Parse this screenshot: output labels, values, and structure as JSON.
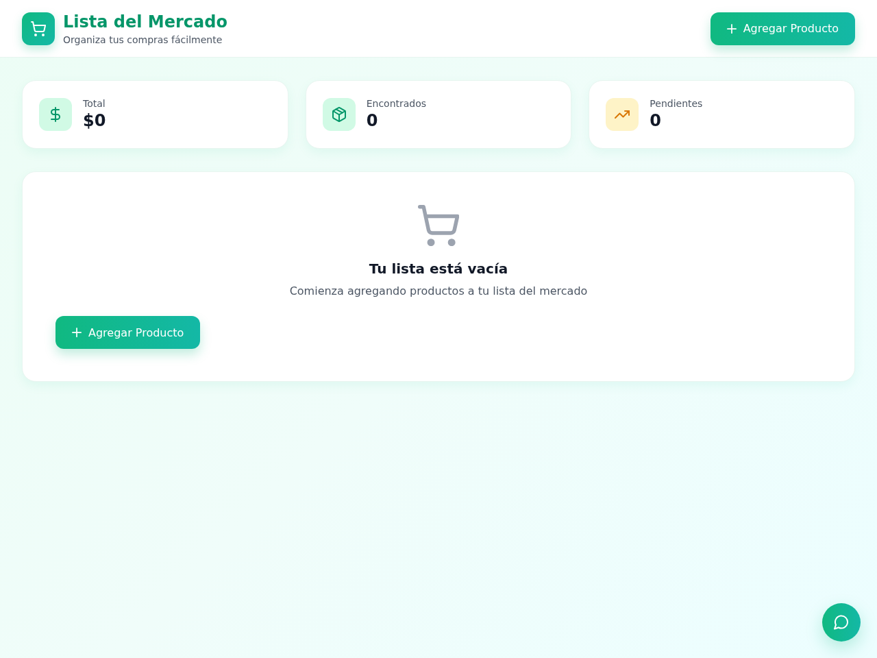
{
  "header": {
    "title": "Lista del Mercado",
    "subtitle": "Organiza tus compras fácilmente",
    "add_button": "Agregar Producto"
  },
  "stats": [
    {
      "kind": "total",
      "label": "Total",
      "value": "$0"
    },
    {
      "kind": "found",
      "label": "Encontrados",
      "value": "0"
    },
    {
      "kind": "pending",
      "label": "Pendientes",
      "value": "0"
    }
  ],
  "empty_state": {
    "title": "Tu lista está vacía",
    "message": "Comienza agregando productos a tu lista del mercado",
    "add_button": "Agregar Producto"
  }
}
